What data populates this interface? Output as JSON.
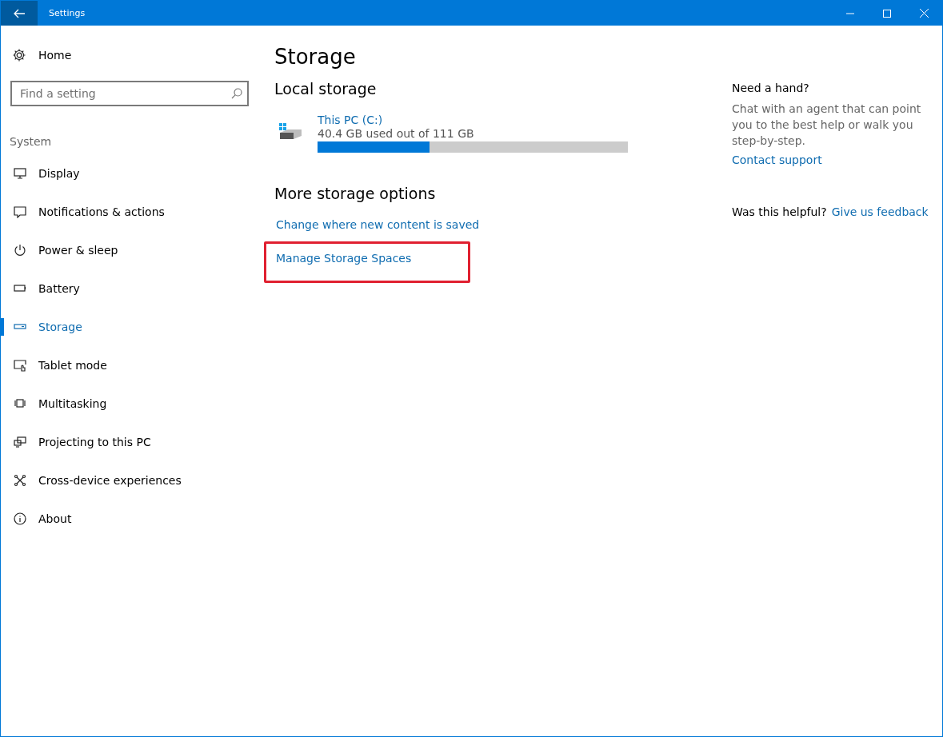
{
  "window": {
    "title": "Settings"
  },
  "sidebar": {
    "home": "Home",
    "search": {
      "placeholder": "Find a setting"
    },
    "group": "System",
    "items": [
      {
        "label": "Display",
        "selected": false
      },
      {
        "label": "Notifications & actions",
        "selected": false
      },
      {
        "label": "Power & sleep",
        "selected": false
      },
      {
        "label": "Battery",
        "selected": false
      },
      {
        "label": "Storage",
        "selected": true
      },
      {
        "label": "Tablet mode",
        "selected": false
      },
      {
        "label": "Multitasking",
        "selected": false
      },
      {
        "label": "Projecting to this PC",
        "selected": false
      },
      {
        "label": "Cross-device experiences",
        "selected": false
      },
      {
        "label": "About",
        "selected": false
      }
    ]
  },
  "main": {
    "title": "Storage",
    "local_heading": "Local storage",
    "drive": {
      "name": "This PC (C:)",
      "usage": "40.4 GB used out of 111 GB",
      "level": 0.36
    },
    "more_heading": "More storage options",
    "links": [
      {
        "label": "Change where new content is saved",
        "highlighted": false
      },
      {
        "label": "Manage Storage Spaces",
        "highlighted": true
      }
    ]
  },
  "help": {
    "heading": "Need a hand?",
    "text": "Chat with an agent that can point you to the best help or walk you step-by-step.",
    "link": "Contact support",
    "feedback_question": "Was this helpful?",
    "feedback_link": "Give us feedback"
  }
}
